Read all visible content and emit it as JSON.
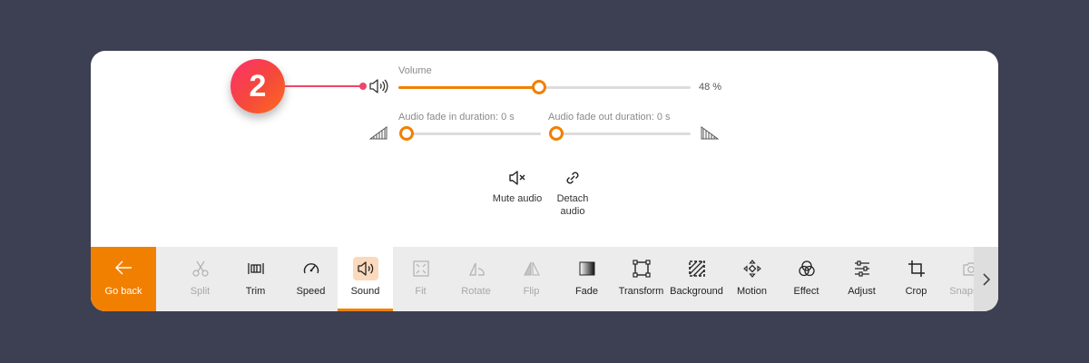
{
  "step_badge": "2",
  "volume": {
    "label": "Volume",
    "value_text": "48 %",
    "value": 48
  },
  "fade_in": {
    "label": "Audio fade in duration: 0 s",
    "value": 0
  },
  "fade_out": {
    "label": "Audio fade out duration: 0 s",
    "value": 0
  },
  "actions": {
    "mute": "Mute audio",
    "detach_line1": "Detach",
    "detach_line2": "audio"
  },
  "toolbar": {
    "go_back": "Go back",
    "tools": [
      {
        "label": "Split",
        "icon": "scissors-icon",
        "enabled": false
      },
      {
        "label": "Trim",
        "icon": "trim-icon",
        "enabled": true
      },
      {
        "label": "Speed",
        "icon": "speedometer-icon",
        "enabled": true
      },
      {
        "label": "Sound",
        "icon": "speaker-icon",
        "enabled": true,
        "active": true
      },
      {
        "label": "Fit",
        "icon": "fit-icon",
        "enabled": false
      },
      {
        "label": "Rotate",
        "icon": "rotate-icon",
        "enabled": false
      },
      {
        "label": "Flip",
        "icon": "flip-icon",
        "enabled": false
      },
      {
        "label": "Fade",
        "icon": "fade-icon",
        "enabled": true
      },
      {
        "label": "Transform",
        "icon": "transform-icon",
        "enabled": true
      },
      {
        "label": "Background",
        "icon": "background-icon",
        "enabled": true
      },
      {
        "label": "Motion",
        "icon": "motion-icon",
        "enabled": true
      },
      {
        "label": "Effect",
        "icon": "effect-icon",
        "enabled": true
      },
      {
        "label": "Adjust",
        "icon": "adjust-icon",
        "enabled": true
      },
      {
        "label": "Crop",
        "icon": "crop-icon",
        "enabled": true
      },
      {
        "label": "Snapshot",
        "icon": "camera-icon",
        "enabled": false
      }
    ]
  },
  "colors": {
    "accent": "#f28000",
    "badge": "#f0456a",
    "background": "#3d3f52"
  }
}
